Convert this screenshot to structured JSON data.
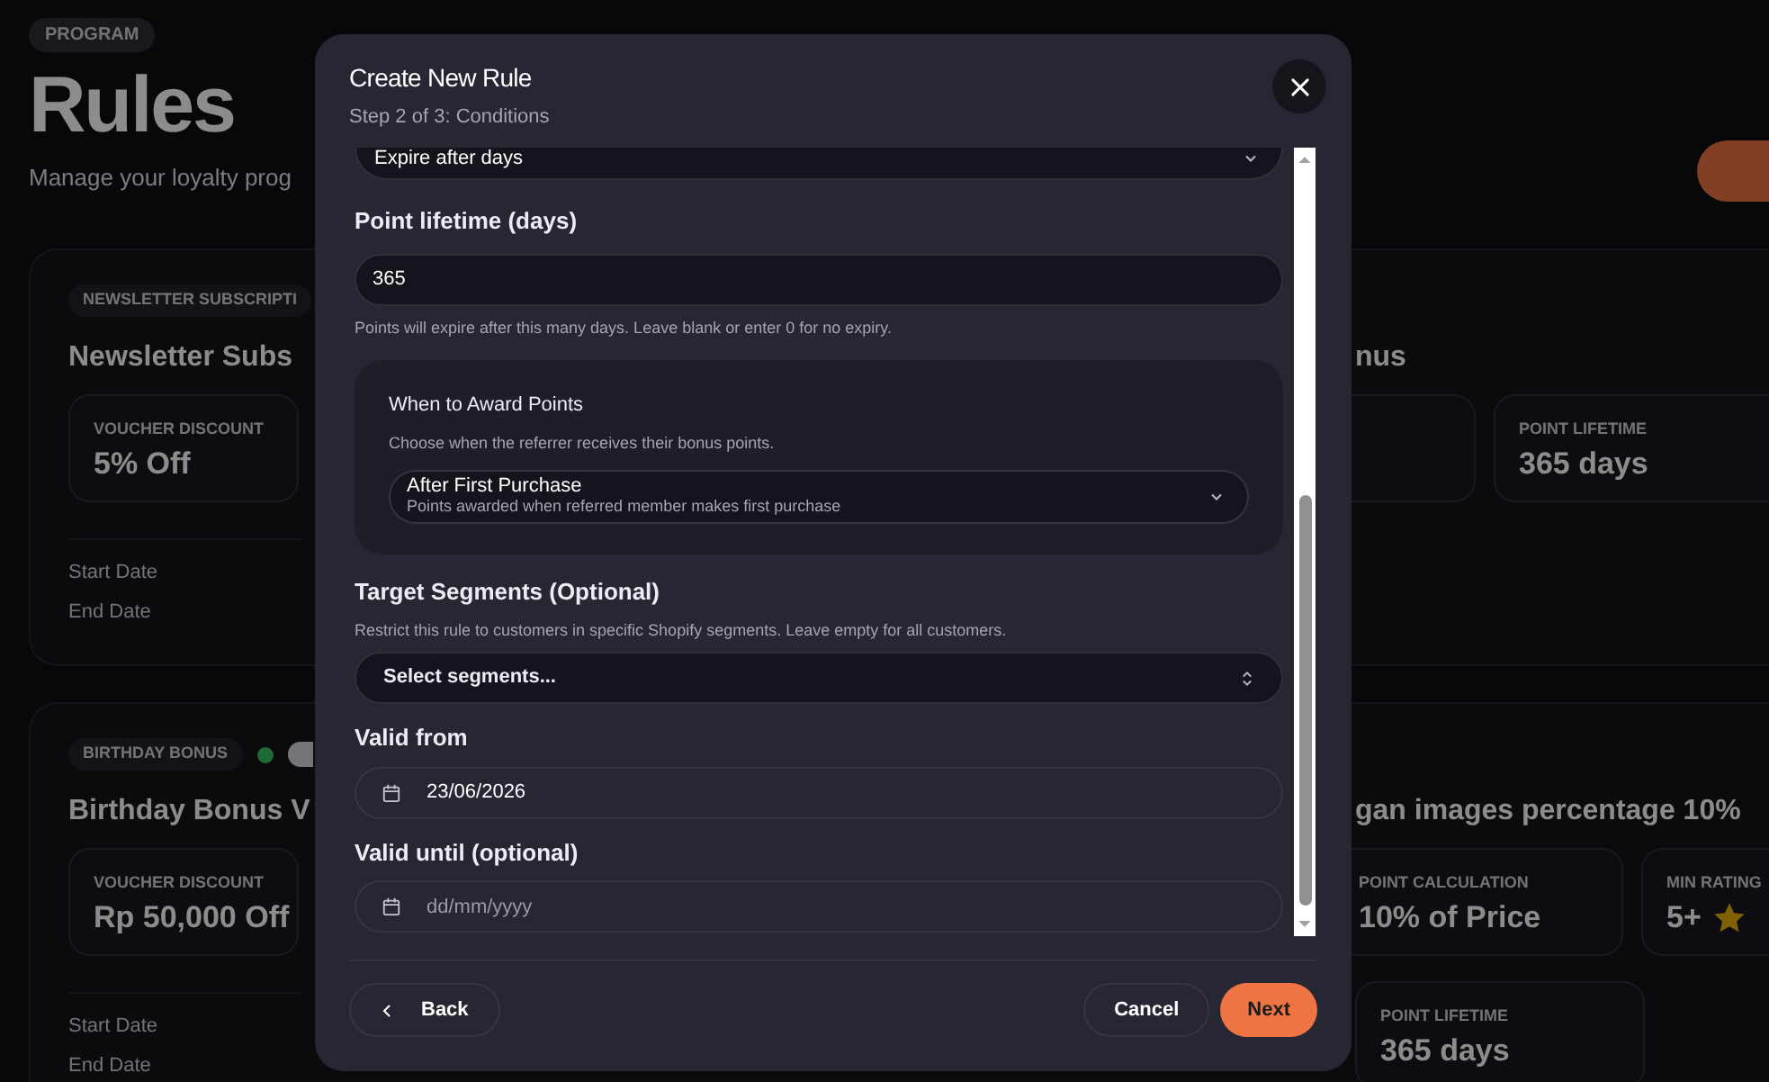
{
  "page": {
    "eyebrow": "PROGRAM",
    "title": "Rules",
    "subtitle": "Manage your loyalty prog"
  },
  "rule_cards": [
    {
      "tag": "NEWSLETTER SUBSCRIPTI",
      "title_left": "Newsletter Subs",
      "title_right": "nus",
      "stats": [
        {
          "kind": "stat",
          "label": "VOUCHER DISCOUNT",
          "value": "5% Off"
        },
        {
          "kind": "blank"
        },
        {
          "kind": "blank"
        },
        {
          "kind": "stat",
          "label": "POINT LIFETIME",
          "value": "365 days"
        }
      ],
      "dates": [
        "Start Date",
        "End Date"
      ]
    },
    {
      "tag": "BIRTHDAY BONUS",
      "color": "#1f6b35",
      "title_left": "Birthday Bonus V",
      "title_right": "gan images percentage 10%",
      "stats": [
        {
          "kind": "stat",
          "label": "VOUCHER DISCOUNT",
          "value": "Rp 50,000 Off"
        },
        {
          "kind": "gap"
        },
        {
          "kind": "stat",
          "label": "POINT CALCULATION",
          "value": "10% of Price"
        },
        {
          "kind": "rating",
          "label": "MIN RATING",
          "value": "5+"
        }
      ],
      "stats_row2": [
        {
          "kind": "stat",
          "label": "POINT LIFETIME",
          "value": "365 days"
        }
      ],
      "dates": [
        "Start Date",
        "End Date"
      ]
    }
  ],
  "modal": {
    "title": "Create New Rule",
    "subtitle": "Step 2 of 3: Conditions",
    "expiry_select": {
      "value": "Expire after days"
    },
    "lifetime": {
      "label": "Point lifetime (days)",
      "value": "365",
      "help": "Points will expire after this many days. Leave blank or enter 0 for no expiry."
    },
    "award": {
      "title": "When to Award Points",
      "description": "Choose when the referrer receives their bonus points.",
      "value": "After First Purchase",
      "value_description": "Points awarded when referred member makes first purchase"
    },
    "segments": {
      "label": "Target Segments (Optional)",
      "help": "Restrict this rule to customers in specific Shopify segments. Leave empty for all customers.",
      "placeholder": "Select segments..."
    },
    "valid_from": {
      "label": "Valid from",
      "value": "23/06/2026"
    },
    "valid_until": {
      "label": "Valid until (optional)",
      "placeholder": "dd/mm/yyyy"
    },
    "buttons": {
      "back": "Back",
      "cancel": "Cancel",
      "next": "Next"
    }
  }
}
